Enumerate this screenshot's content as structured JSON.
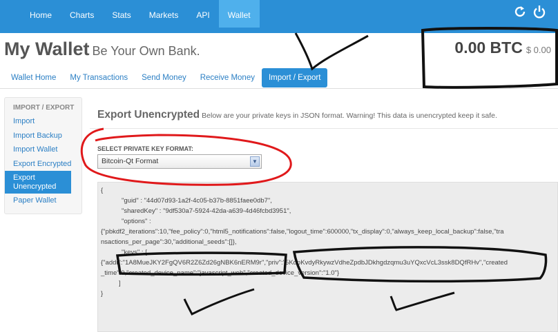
{
  "nav": {
    "items": [
      "Home",
      "Charts",
      "Stats",
      "Markets",
      "API",
      "Wallet"
    ],
    "active": "Wallet"
  },
  "icons": {
    "refresh": "refresh-icon",
    "power": "power-icon"
  },
  "header": {
    "title": "My Wallet",
    "subtitle": "Be Your Own Bank.",
    "btc_balance": "0.00 BTC",
    "usd_balance": "$ 0.00"
  },
  "tabs": {
    "items": [
      "Wallet Home",
      "My Transactions",
      "Send Money",
      "Receive Money",
      "Import / Export"
    ],
    "active": "Import / Export"
  },
  "sidebar": {
    "heading": "IMPORT / EXPORT",
    "items": [
      "Import",
      "Import Backup",
      "Import Wallet",
      "Export Encrypted",
      "Export Unencrypted",
      "Paper Wallet"
    ],
    "active": "Export Unencrypted"
  },
  "export": {
    "title": "Export Unencrypted",
    "description": "Below are your private keys in JSON format. Warning! This data is unencrypted keep it safe.",
    "format_label": "SELECT PRIVATE KEY FORMAT:",
    "format_value": "Bitcoin-Qt Format"
  },
  "json_lines": [
    "{",
    "\"guid\" : \"44d07d93-1a2f-4c05-b37b-8851faee0db7\",",
    "\"sharedKey\" : \"9df530a7-5924-42da-a639-4d46fcbd3951\",",
    "\"options\" :",
    "{\"pbkdf2_iterations\":10,\"fee_policy\":0,\"html5_notifications\":false,\"logout_time\":600000,\"tx_display\":0,\"always_keep_local_backup\":false,\"tra",
    "nsactions_per_page\":30,\"additional_seeds\":[]},",
    "\"keys\" : [",
    "{\"addr\":\"1A8MueJKY2FgQV6R2Z6Zd26gNBK6nERM9r\",\"priv\":\"5KdpKvdyRkywzVdheZpdbJDkhgdzqmu3uYQxcVcL3ssk8DQfRHv\",\"created",
    "_time\":0,\"created_device_name\":\"javascript_web\",\"created_device_version\":\"1.0\"}",
    "]",
    "}"
  ],
  "colors": {
    "navbar": "#2b8fd6",
    "active_tab": "#4fb0ec",
    "link": "#2b7fc4",
    "annotation_red": "#e0191b",
    "annotation_ink": "#111111"
  }
}
